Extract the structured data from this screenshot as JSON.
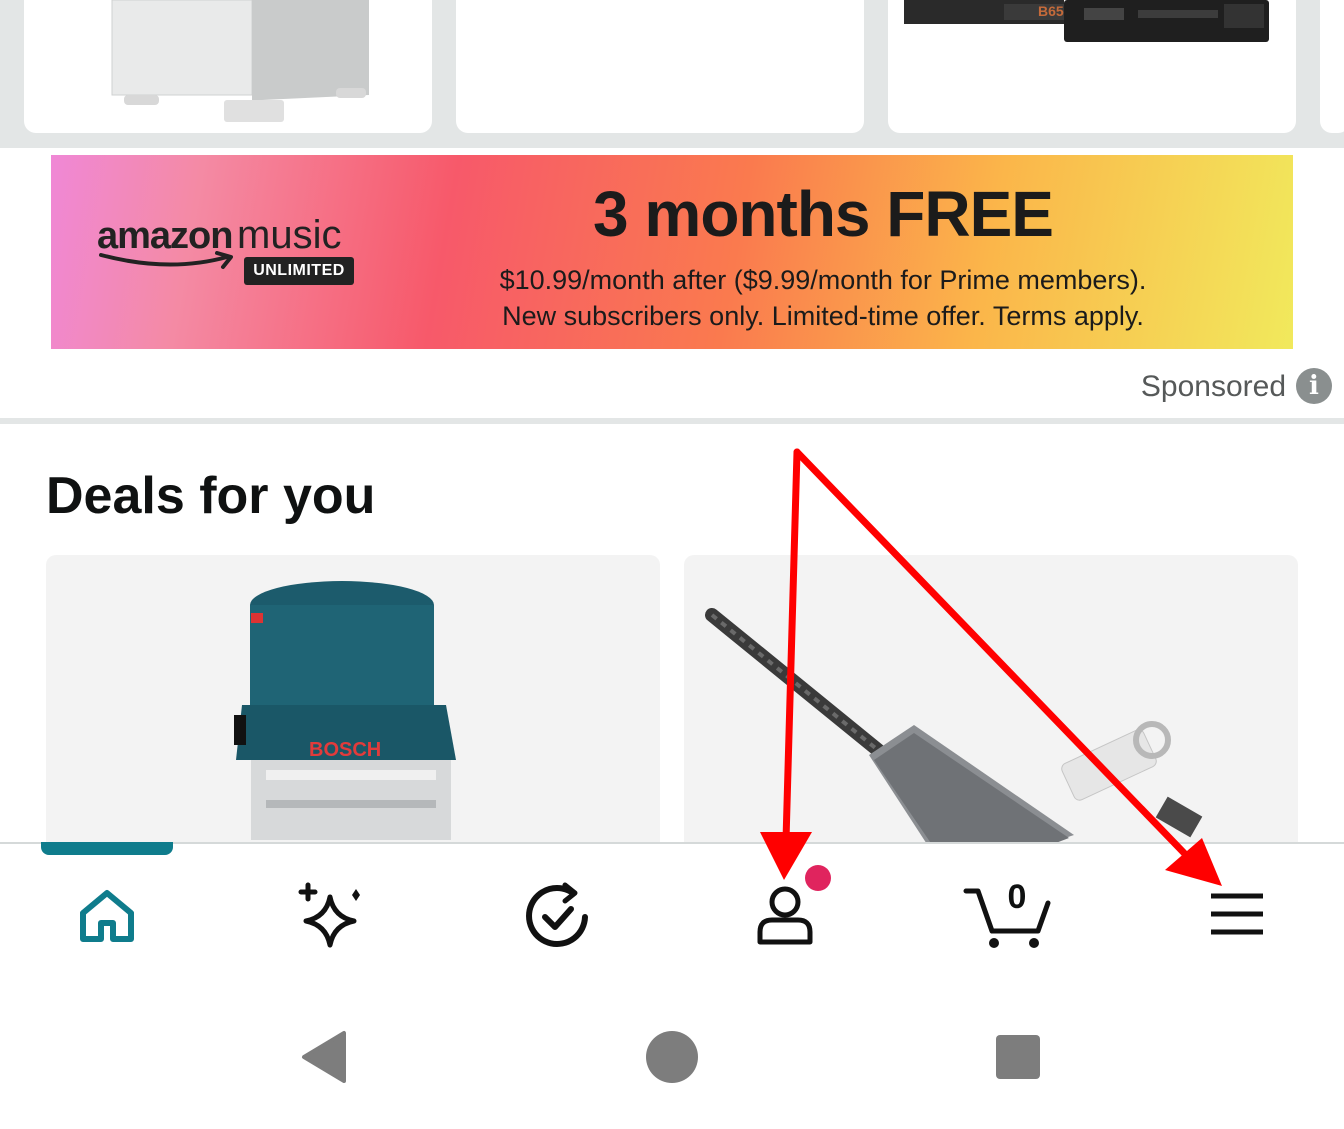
{
  "banner": {
    "brand_amazon": "amazon",
    "brand_music": "music",
    "brand_unlimited": "UNLIMITED",
    "headline": "3 months FREE",
    "line1": "$10.99/month after ($9.99/month for Prime members).",
    "line2": "New subscribers only. Limited-time offer. Terms apply."
  },
  "sponsored": {
    "label": "Sponsored",
    "info": "i"
  },
  "deals": {
    "title": "Deals for you",
    "card1_brand": "BOSCH"
  },
  "bottom_nav": {
    "items": [
      {
        "icon": "home-icon"
      },
      {
        "icon": "sparkle-icon"
      },
      {
        "icon": "recent-check-icon"
      },
      {
        "icon": "account-icon"
      },
      {
        "icon": "cart-icon"
      },
      {
        "icon": "menu-icon"
      }
    ],
    "cart_count": "0",
    "active_color": "#0f7c8c",
    "notify_color": "#e0245e"
  },
  "annotation": {
    "arrow_color": "#ff0000"
  },
  "system_nav": {
    "buttons": [
      "back-icon",
      "home-circle-icon",
      "recents-square-icon"
    ]
  }
}
